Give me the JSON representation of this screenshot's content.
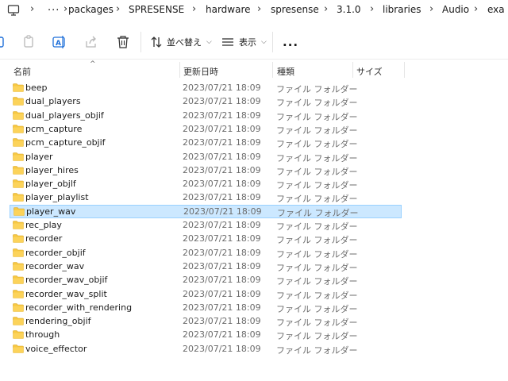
{
  "breadcrumb": {
    "items": [
      "packages",
      "SPRESENSE",
      "hardware",
      "spresense",
      "3.1.0",
      "libraries",
      "Audio",
      "exa"
    ],
    "overflow_label": "..."
  },
  "toolbar": {
    "sort_label": "並べ替え",
    "view_label": "表示",
    "more_label": "..."
  },
  "columns": {
    "name": "名前",
    "date": "更新日時",
    "type": "種類",
    "size": "サイズ"
  },
  "files": [
    {
      "name": "beep",
      "date": "2023/07/21 18:09",
      "type": "ファイル フォルダー"
    },
    {
      "name": "dual_players",
      "date": "2023/07/21 18:09",
      "type": "ファイル フォルダー"
    },
    {
      "name": "dual_players_objif",
      "date": "2023/07/21 18:09",
      "type": "ファイル フォルダー"
    },
    {
      "name": "pcm_capture",
      "date": "2023/07/21 18:09",
      "type": "ファイル フォルダー"
    },
    {
      "name": "pcm_capture_objif",
      "date": "2023/07/21 18:09",
      "type": "ファイル フォルダー"
    },
    {
      "name": "player",
      "date": "2023/07/21 18:09",
      "type": "ファイル フォルダー"
    },
    {
      "name": "player_hires",
      "date": "2023/07/21 18:09",
      "type": "ファイル フォルダー"
    },
    {
      "name": "player_objlf",
      "date": "2023/07/21 18:09",
      "type": "ファイル フォルダー"
    },
    {
      "name": "player_playlist",
      "date": "2023/07/21 18:09",
      "type": "ファイル フォルダー"
    },
    {
      "name": "player_wav",
      "date": "2023/07/21 18:09",
      "type": "ファイル フォルダー",
      "selected": true
    },
    {
      "name": "rec_play",
      "date": "2023/07/21 18:09",
      "type": "ファイル フォルダー"
    },
    {
      "name": "recorder",
      "date": "2023/07/21 18:09",
      "type": "ファイル フォルダー"
    },
    {
      "name": "recorder_objif",
      "date": "2023/07/21 18:09",
      "type": "ファイル フォルダー"
    },
    {
      "name": "recorder_wav",
      "date": "2023/07/21 18:09",
      "type": "ファイル フォルダー"
    },
    {
      "name": "recorder_wav_objif",
      "date": "2023/07/21 18:09",
      "type": "ファイル フォルダー"
    },
    {
      "name": "recorder_wav_split",
      "date": "2023/07/21 18:09",
      "type": "ファイル フォルダー"
    },
    {
      "name": "recorder_with_rendering",
      "date": "2023/07/21 18:09",
      "type": "ファイル フォルダー"
    },
    {
      "name": "rendering_objif",
      "date": "2023/07/21 18:09",
      "type": "ファイル フォルダー"
    },
    {
      "name": "through",
      "date": "2023/07/21 18:09",
      "type": "ファイル フォルダー"
    },
    {
      "name": "voice_effector",
      "date": "2023/07/21 18:09",
      "type": "ファイル フォルダー"
    }
  ],
  "colors": {
    "selection_bg": "#cce8ff",
    "selection_border": "#99d1ff",
    "folder_yellow": "#f7c843",
    "secondary_text": "#6b6b6b"
  },
  "icons": {
    "pc": "pc-monitor-icon",
    "folder": "folder-icon",
    "copy": "copy-icon",
    "rename": "rename-icon",
    "share": "share-icon",
    "delete": "trash-icon",
    "sort": "sort-icon",
    "view": "view-list-icon"
  }
}
